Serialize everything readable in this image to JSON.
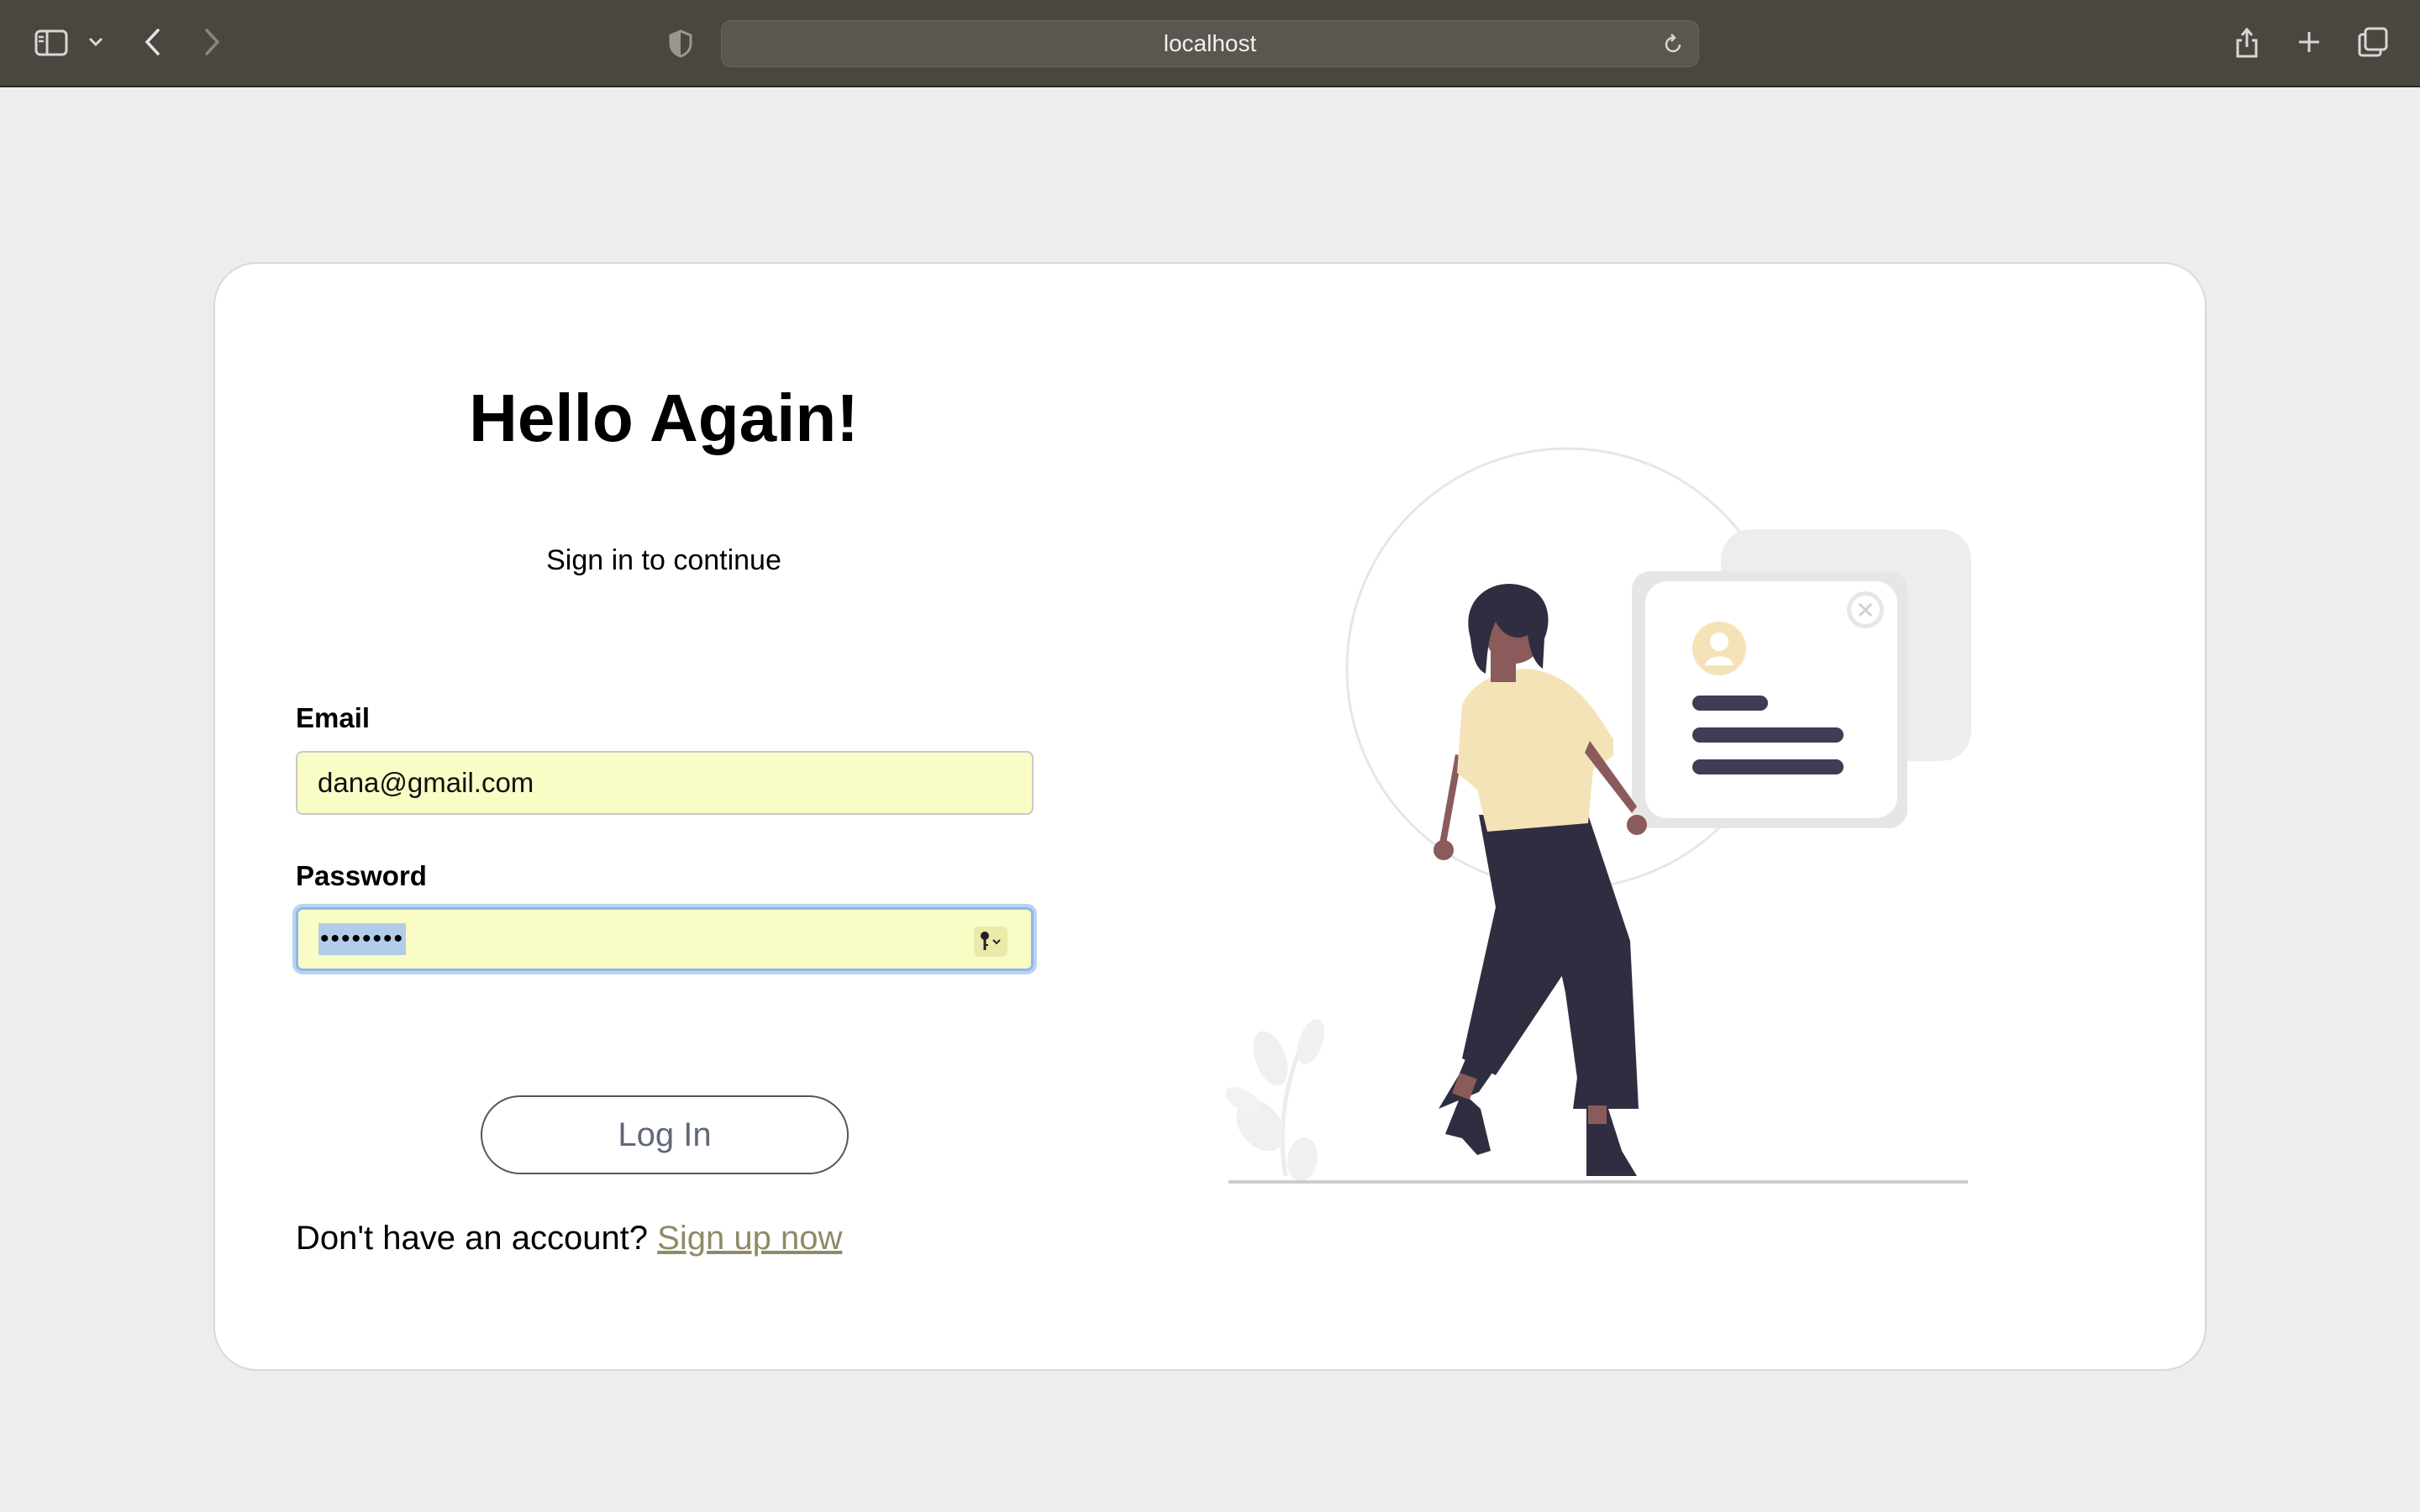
{
  "browser": {
    "address": "localhost",
    "icons": [
      "sidebar-icon",
      "chevron-down-icon",
      "back-icon",
      "forward-icon",
      "shield-icon",
      "reload-icon",
      "share-icon",
      "plus-icon",
      "tabs-icon"
    ]
  },
  "login": {
    "title": "Hello Again!",
    "subtitle": "Sign in to continue",
    "email_label": "Email",
    "email_value": "dana@gmail.com",
    "password_label": "Password",
    "password_value": "••••••••",
    "login_button": "Log In",
    "signup_prompt": "Don't have an account?",
    "signup_link": "Sign up now"
  },
  "colors": {
    "autofill_bg": "#fafcc6",
    "link": "#8f8a67",
    "shirt": "#f5e3b8",
    "pants": "#2f2e41",
    "skin": "#8b5a5a"
  }
}
